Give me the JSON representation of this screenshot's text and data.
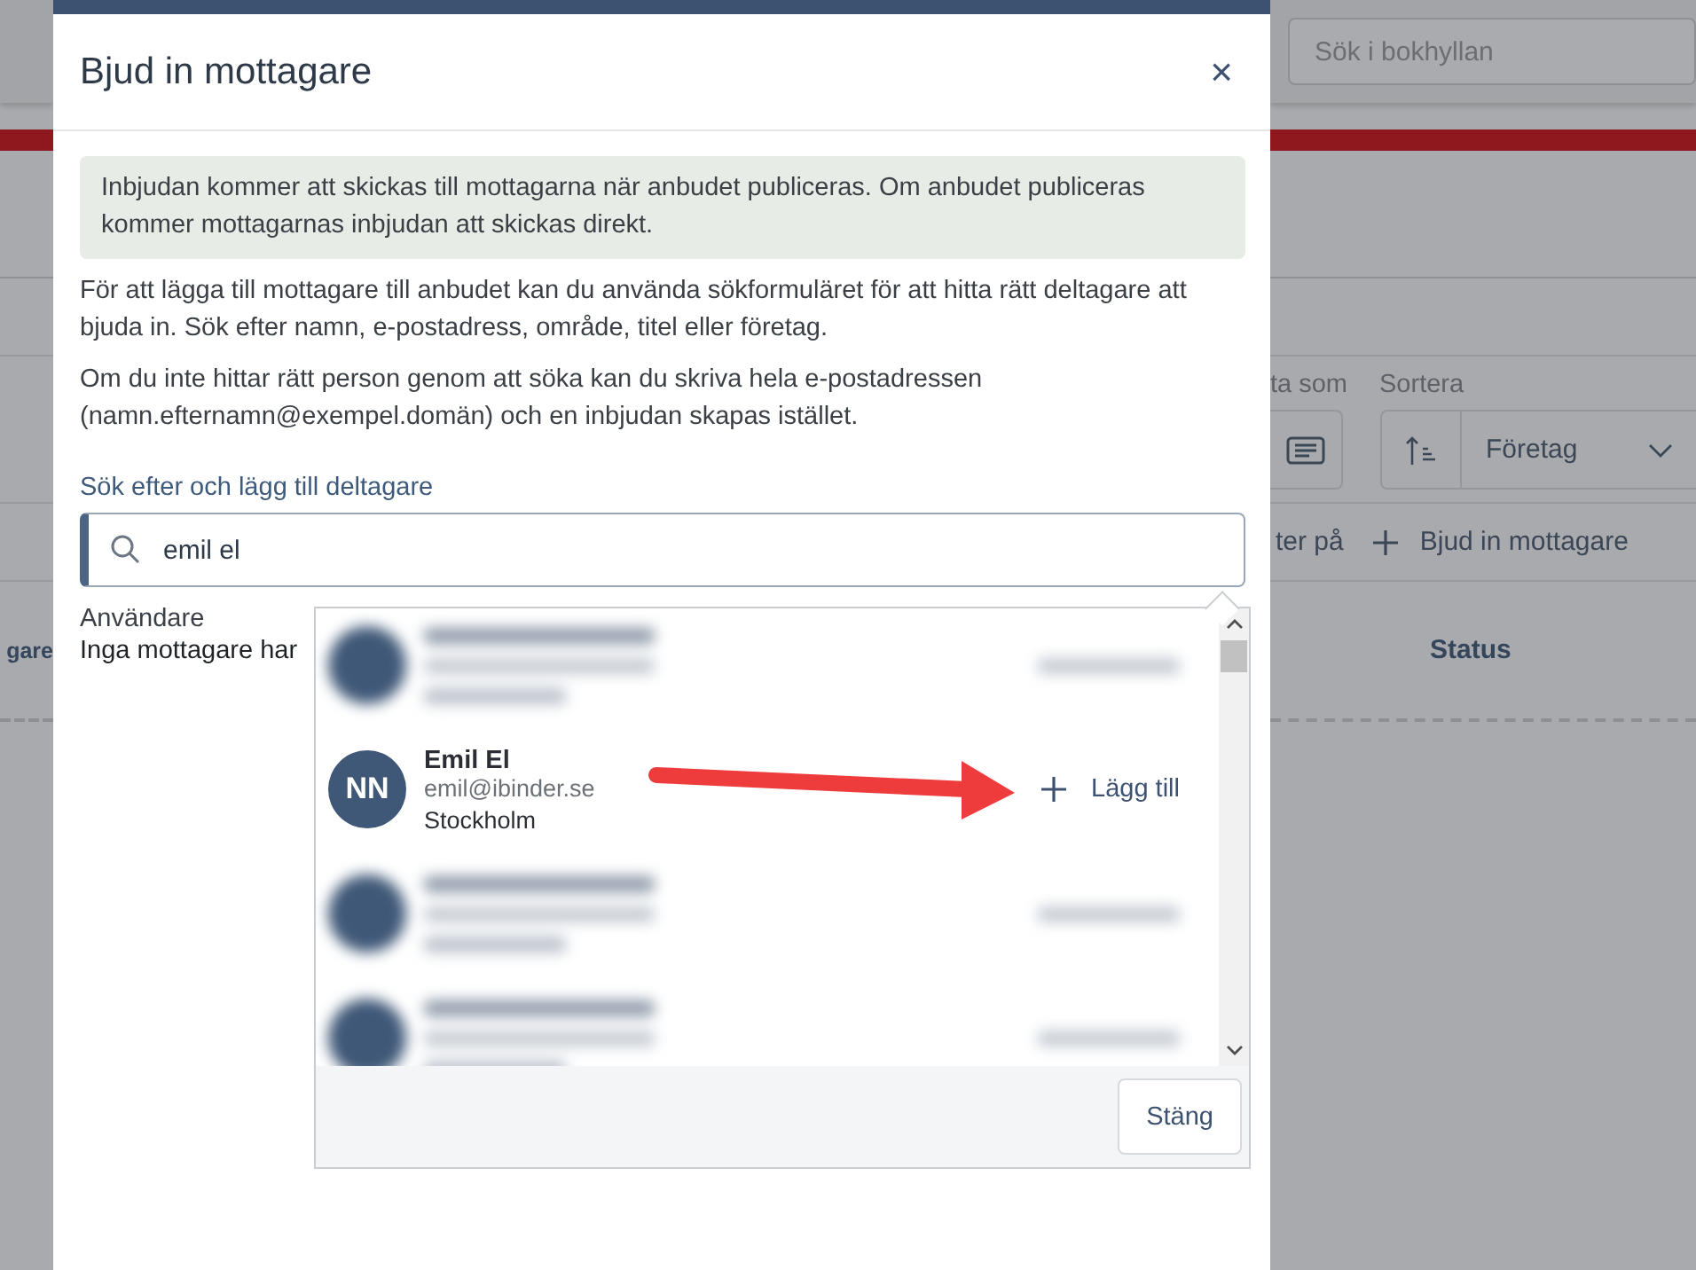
{
  "background": {
    "search": {
      "placeholder": "Sök i bokhyllan"
    },
    "view_label": "ta som",
    "sort_label": "Sortera",
    "sort_value": "Företag",
    "filter_text": "ter på",
    "invite_button": "Bjud in mottagare",
    "left_column_heading": "gare",
    "status_heading": "Status"
  },
  "dialog": {
    "title": "Bjud in mottagare",
    "close": "×",
    "info": "Inbjudan kommer att skickas till mottagarna när anbudet publiceras. Om anbudet publiceras kommer mottagarnas inbjudan att skickas direkt.",
    "paragraphs": [
      "För att lägga till mottagare till anbudet kan du använda sökformuläret för att hitta rätt deltagare att bjuda in. Sök efter namn, e-postadress, område, titel eller företag.",
      "Om du inte hittar rätt person genom att söka kan du skriva hela e-postadressen (namn.efternamn@exempel.domän) och en inbjudan skapas istället."
    ],
    "search_label": "Sök efter och lägg till deltagare",
    "search_value": "emil el",
    "section_label": "Användare",
    "empty_text": "Inga mottagare har",
    "results": [
      {
        "kind": "blurred"
      },
      {
        "kind": "person",
        "initials": "NN",
        "name": "Emil El",
        "email": "emil@ibinder.se",
        "city": "Stockholm",
        "action": "Lägg till"
      },
      {
        "kind": "blurred"
      },
      {
        "kind": "blurred"
      }
    ],
    "close_button": "Stäng"
  }
}
